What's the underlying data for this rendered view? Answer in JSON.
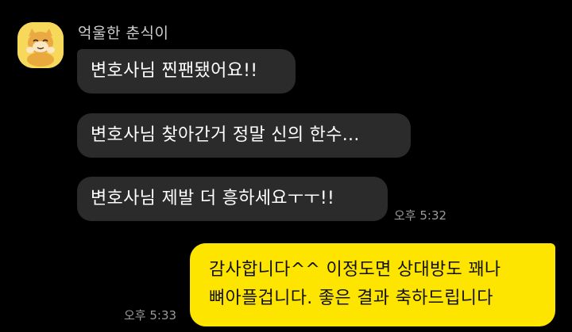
{
  "chat": {
    "sender": {
      "name": "억울한 춘식이",
      "avatar_icon": "cat-character-avatar-icon",
      "avatar_color": "#f6d85a"
    },
    "incoming": [
      {
        "text": "변호사님 찐팬됐어요!!"
      },
      {
        "text": "변호사님 찾아간거 정말 신의 한수..."
      },
      {
        "text": "변호사님 제발 더 흥하세요ㅜㅜ!!"
      }
    ],
    "incoming_time": "오후 5:32",
    "outgoing": {
      "line1": "감사합니다^^ 이정도면 상대방도 꽤나",
      "line2": "뼈아플겁니다. 좋은 결과 축하드립니다"
    },
    "outgoing_time": "오후 5:33",
    "colors": {
      "background": "#000000",
      "incoming_bubble": "#2b2b2b",
      "outgoing_bubble": "#fee500"
    }
  }
}
